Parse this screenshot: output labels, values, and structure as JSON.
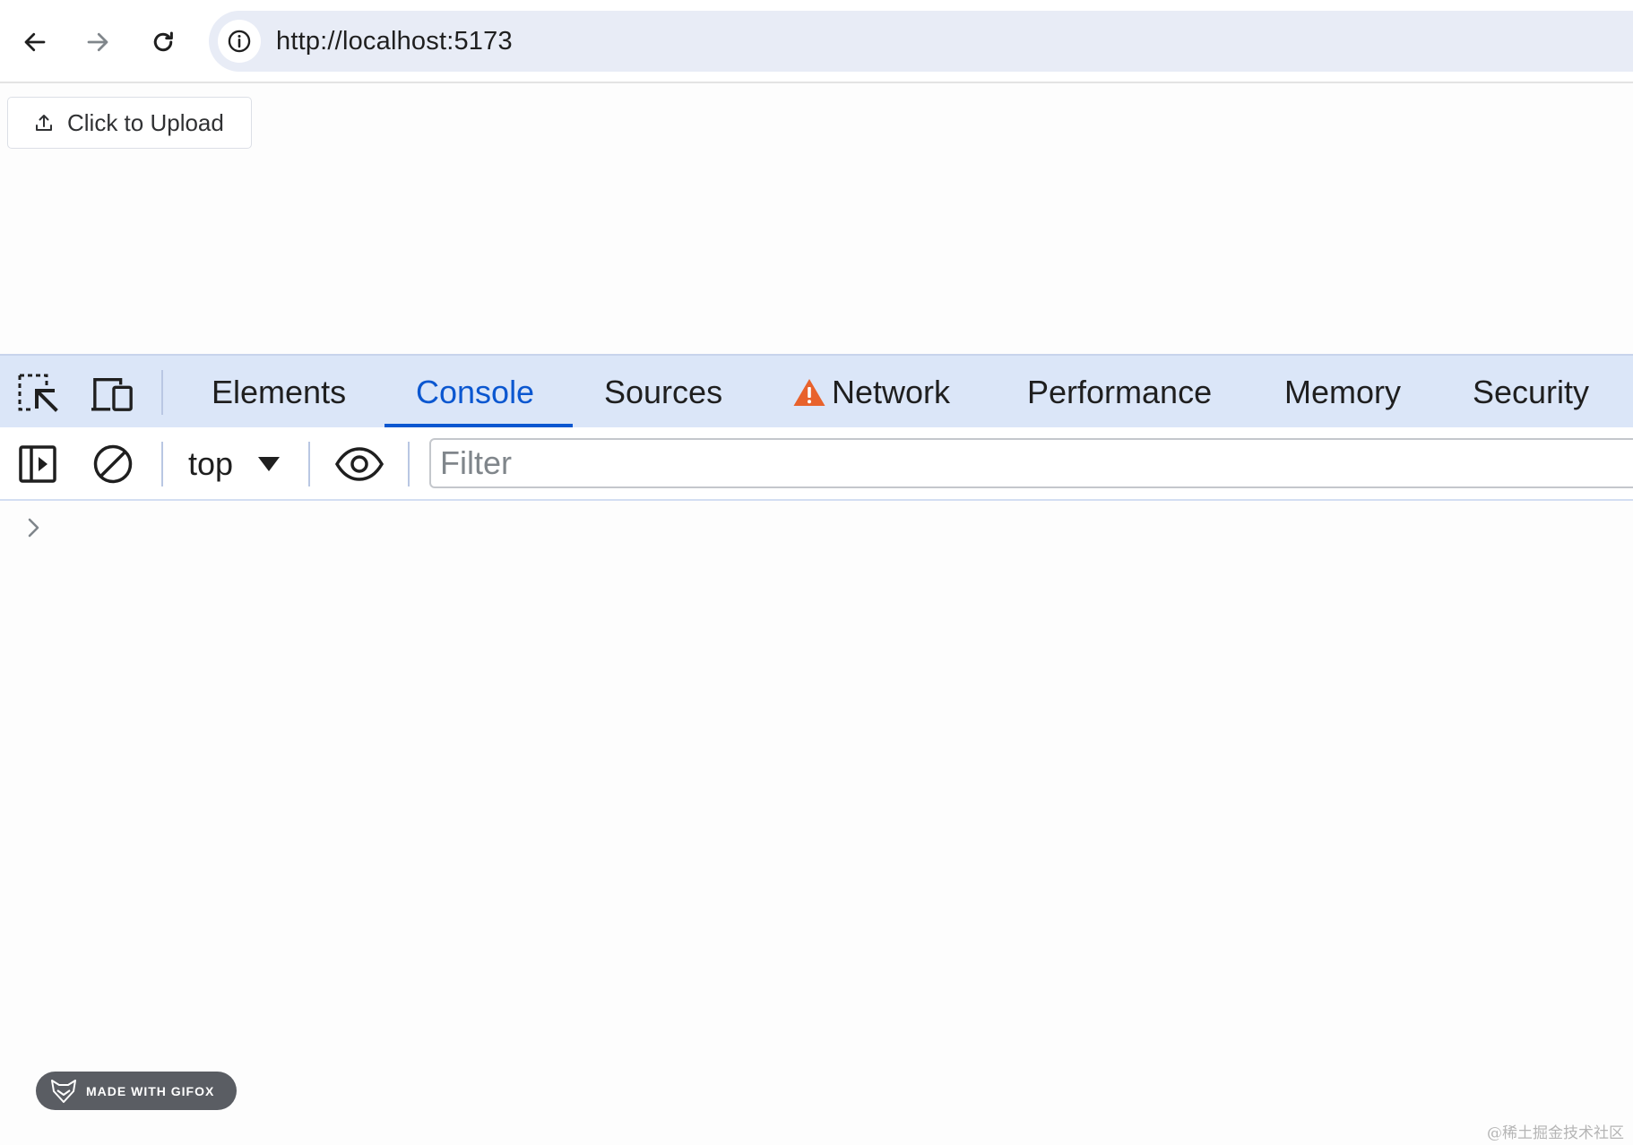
{
  "browser": {
    "url": "http://localhost:5173",
    "icons": [
      "back-arrow-icon",
      "forward-arrow-icon",
      "reload-icon",
      "info-icon"
    ]
  },
  "page": {
    "upload_button_label": "Click to Upload",
    "upload_icon": "upload-icon"
  },
  "devtools": {
    "tabs": [
      {
        "label": "Elements",
        "active": false
      },
      {
        "label": "Console",
        "active": true
      },
      {
        "label": "Sources",
        "active": false
      },
      {
        "label": "Network",
        "active": false,
        "warning": true
      },
      {
        "label": "Performance",
        "active": false
      },
      {
        "label": "Memory",
        "active": false
      },
      {
        "label": "Security",
        "active": false
      }
    ],
    "colors": {
      "tab_strip": "#dbe6f8",
      "active_tab": "#0b57d0",
      "warning": "#e8622c"
    },
    "console": {
      "context": "top",
      "filter_placeholder": "Filter",
      "filter_value": ""
    }
  },
  "badge": {
    "label": "MADE WITH GIFOX"
  },
  "watermark": "@稀土掘金技术社区"
}
